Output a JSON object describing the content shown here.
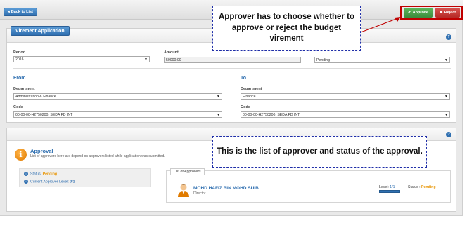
{
  "toolbar": {
    "back_label": "Back to List",
    "approve_label": "Approve",
    "reject_label": "Reject"
  },
  "virement": {
    "tab_title": "Virement Application",
    "period_label": "Period",
    "period_value": "2016",
    "amount_label": "Amount",
    "amount_value": "50000.00",
    "status_value": "Pending",
    "from_title": "From",
    "to_title": "To",
    "department_label": "Department",
    "code_label": "Code",
    "from_department": "Administration & Finance",
    "from_code": "00-00-00-H2750200: SEDA FD INT",
    "to_department": "Finance",
    "to_code": "00-00-00-H2750200: SEDA FD INT"
  },
  "approval": {
    "title": "Approval",
    "description": "List of approvers here are depend on approvers listed while application was submitted.",
    "status_label": "Status:",
    "status_value": "Pending",
    "current_level_label": "Current Approver Level:",
    "current_level_value": "0/1",
    "list_tab": "List of Approvers",
    "approver_name": "MOHD HAFIZ BIN MOHD SUIB",
    "approver_role": "Director",
    "level_label": "Level:",
    "level_value": "1/1",
    "approver_status_label": "Status :",
    "approver_status_value": "Pending"
  },
  "annotations": {
    "callout_top": "Approver has to choose whether to approve or reject the budget virement",
    "callout_bottom": "This is the list of approver and status of the approval."
  },
  "icons": {
    "back": "arrow-left-icon",
    "approve": "check-icon",
    "reject": "close-icon",
    "help": "question-icon",
    "info": "info-icon",
    "person": "user-avatar-icon"
  },
  "colors": {
    "primary": "#2f6fb0",
    "approve": "#4cae4c",
    "reject": "#c9302c",
    "pending": "#e89400",
    "highlight": "#c00000",
    "callout_border": "#1f2ea8"
  }
}
